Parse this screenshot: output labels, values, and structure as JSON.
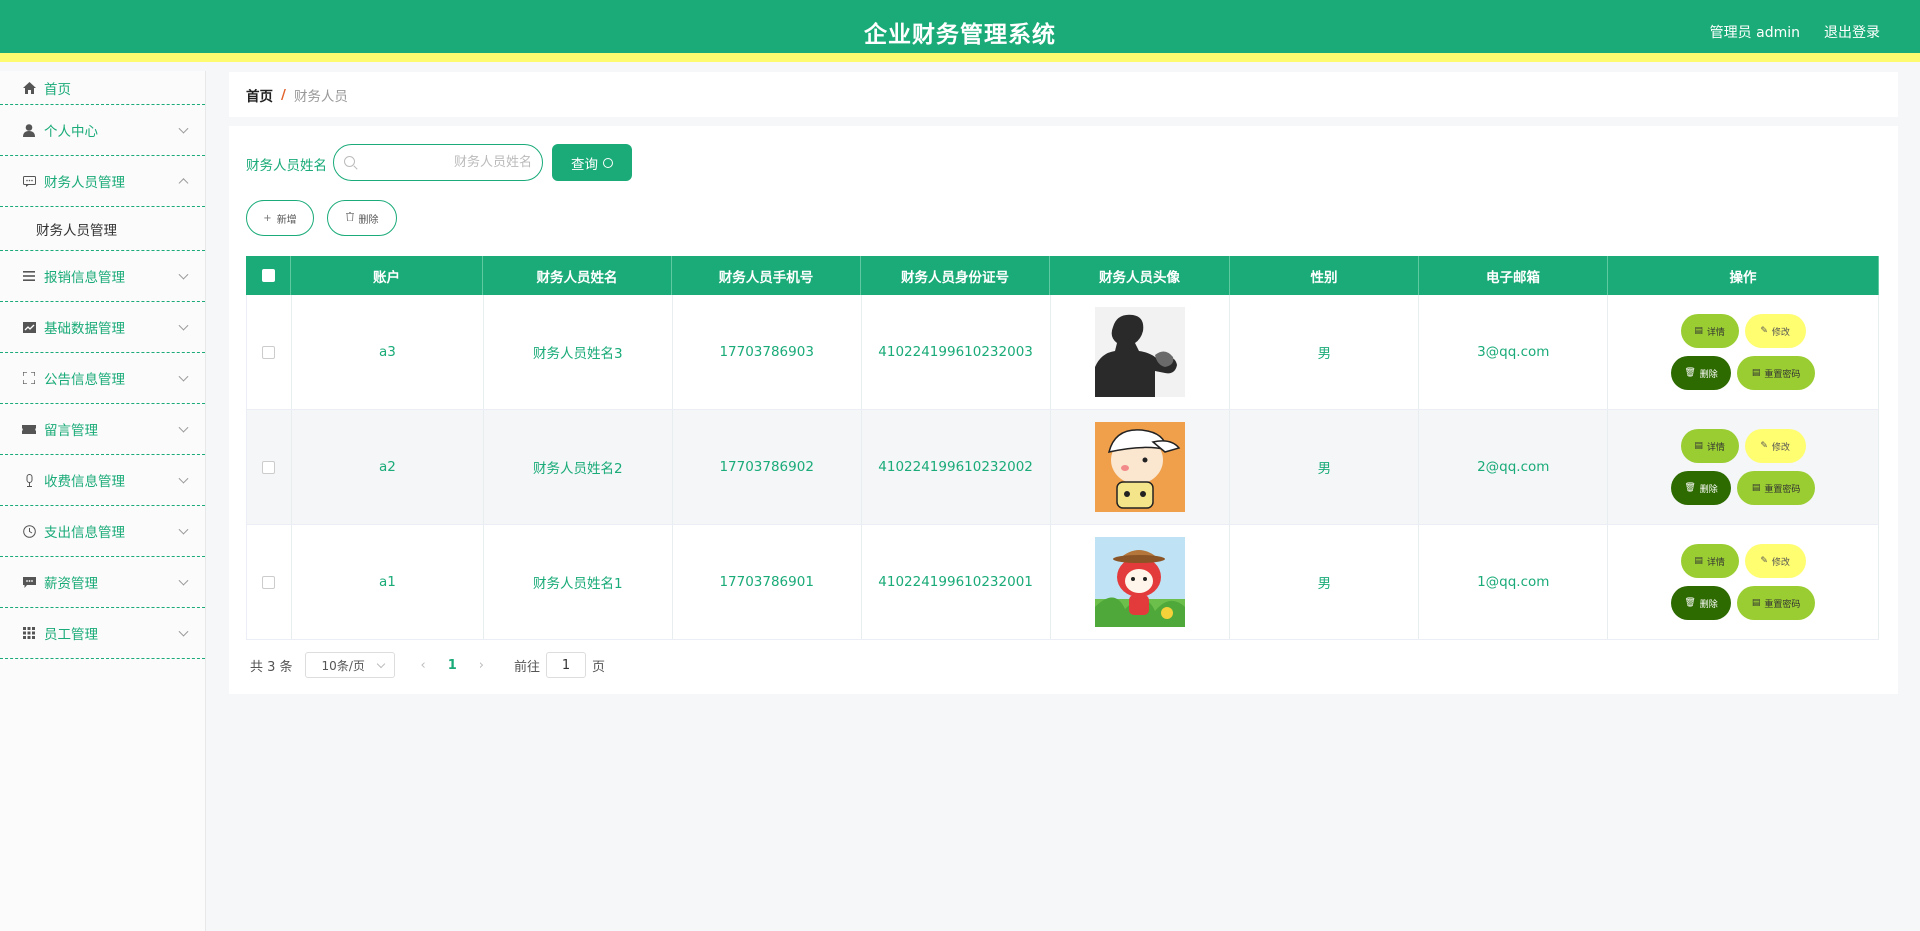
{
  "header": {
    "title": "企业财务管理系统",
    "user": "管理员 admin",
    "logout": "退出登录"
  },
  "colors": {
    "primary": "#1aab78",
    "accent_strip": "#fffb70",
    "detail_btn": "#9acd32",
    "edit_btn": "#fffd70",
    "delete_btn": "#2d6a00"
  },
  "sidebar": {
    "items": [
      {
        "label": "首页",
        "icon": "home-icon"
      },
      {
        "label": "个人中心",
        "icon": "user-icon"
      },
      {
        "label": "财务人员管理",
        "icon": "chat-icon",
        "sub": "财务人员管理"
      },
      {
        "label": "报销信息管理",
        "icon": "list-icon"
      },
      {
        "label": "基础数据管理",
        "icon": "chart-icon"
      },
      {
        "label": "公告信息管理",
        "icon": "fullscreen-icon"
      },
      {
        "label": "留言管理",
        "icon": "ticket-icon"
      },
      {
        "label": "收费信息管理",
        "icon": "mic-icon"
      },
      {
        "label": "支出信息管理",
        "icon": "clock-icon"
      },
      {
        "label": "薪资管理",
        "icon": "message-icon"
      },
      {
        "label": "员工管理",
        "icon": "grid-icon"
      }
    ]
  },
  "breadcrumb": {
    "home": "首页",
    "separator": "/",
    "current": "财务人员"
  },
  "search": {
    "label": "财务人员姓名",
    "placeholder": "财务人员姓名",
    "value": "",
    "button": "查询"
  },
  "actions": {
    "add": "新增",
    "delete": "删除"
  },
  "table": {
    "columns": [
      "账户",
      "财务人员姓名",
      "财务人员手机号",
      "财务人员身份证号",
      "财务人员头像",
      "性别",
      "电子邮箱",
      "操作"
    ],
    "rows": [
      {
        "account": "a3",
        "name": "财务人员姓名3",
        "phone": "17703786903",
        "id_card": "410224199610232003",
        "avatar": "grayscale-man-photo",
        "gender": "男",
        "email": "3@qq.com"
      },
      {
        "account": "a2",
        "name": "财务人员姓名2",
        "phone": "17703786902",
        "id_card": "410224199610232002",
        "avatar": "cartoon-boy-cap",
        "gender": "男",
        "email": "2@qq.com"
      },
      {
        "account": "a1",
        "name": "财务人员姓名1",
        "phone": "17703786901",
        "id_card": "410224199610232001",
        "avatar": "cartoon-fox-hat",
        "gender": "男",
        "email": "1@qq.com"
      }
    ],
    "row_actions": {
      "detail": "详情",
      "edit": "修改",
      "delete": "删除",
      "reset": "重置密码"
    }
  },
  "pagination": {
    "total": "共 3 条",
    "page_size": "10条/页",
    "current_page": "1",
    "goto_label": "前往",
    "goto_value": "1",
    "page_suffix": "页"
  }
}
